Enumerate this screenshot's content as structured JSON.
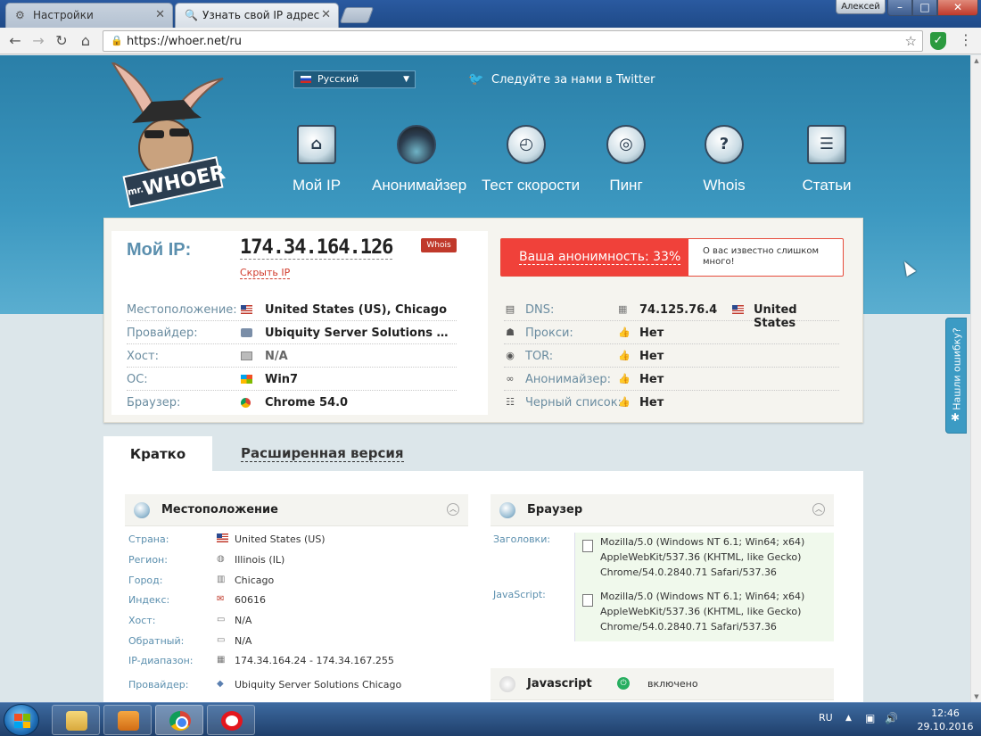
{
  "browser": {
    "tabs": [
      {
        "title": "Настройки",
        "icon": "gear-icon"
      },
      {
        "title": "Узнать свой IP адрес",
        "icon": "search-icon"
      }
    ],
    "profile_name": "Алексей",
    "url": "https://whoer.net/ru"
  },
  "header": {
    "logo_small": "mr.",
    "logo_text": "WHOER",
    "language": "Русский",
    "twitter_text": "Следуйте за нами в Twitter",
    "nav": [
      {
        "label": "Мой IP",
        "icon": "home-icon"
      },
      {
        "label": "Анонимайзер",
        "icon": "spy-hat-icon"
      },
      {
        "label": "Тест скорости",
        "icon": "speedometer-icon"
      },
      {
        "label": "Пинг",
        "icon": "ping-icon"
      },
      {
        "label": "Whois",
        "icon": "question-icon"
      },
      {
        "label": "Статьи",
        "icon": "articles-icon"
      }
    ]
  },
  "ip_panel": {
    "my_ip_label": "Мой IP:",
    "ip": "174.34.164.126",
    "hide_ip": "Скрыть IP",
    "whois_badge": "Whois",
    "rows": [
      {
        "label": "Местоположение:",
        "value": "United States (US), Chicago",
        "icon": "us-flag-icon"
      },
      {
        "label": "Провайдер:",
        "value": "Ubiquity Server Solutions Chic…",
        "icon": "provider-icon"
      },
      {
        "label": "Хост:",
        "value": "N/A",
        "icon": "host-icon"
      },
      {
        "label": "ОС:",
        "value": "Win7",
        "icon": "windows-icon"
      },
      {
        "label": "Браузер:",
        "value": "Chrome 54.0",
        "icon": "chrome-icon"
      }
    ],
    "anonymity_label": "Ваша анонимность: 33%",
    "anonymity_percent": 33,
    "anonymity_note": "О вас известно слишком много!",
    "checks": [
      {
        "label": "DNS:",
        "value": "74.125.76.4",
        "extra": "United States",
        "icon": "dns-icon"
      },
      {
        "label": "Прокси:",
        "value": "Нет",
        "icon": "proxy-icon"
      },
      {
        "label": "TOR:",
        "value": "Нет",
        "icon": "tor-icon"
      },
      {
        "label": "Анонимайзер:",
        "value": "Нет",
        "icon": "glasses-icon"
      },
      {
        "label": "Черный список:",
        "value": "Нет",
        "icon": "blacklist-icon"
      }
    ]
  },
  "tabs": {
    "short": "Кратко",
    "extended": "Расширенная версия"
  },
  "location_section": {
    "title": "Местоположение",
    "rows": [
      {
        "label": "Страна:",
        "value": "United States (US)"
      },
      {
        "label": "Регион:",
        "value": "Illinois (IL)"
      },
      {
        "label": "Город:",
        "value": "Chicago"
      },
      {
        "label": "Индекс:",
        "value": "60616"
      },
      {
        "label": "Хост:",
        "value": "N/A"
      },
      {
        "label": "Обратный:",
        "value": "N/A"
      },
      {
        "label": "IP-диапазон:",
        "value": "174.34.164.24 - 174.34.167.255"
      },
      {
        "label": "Провайдер:",
        "value": "Ubiquity Server Solutions Chicago"
      }
    ]
  },
  "browser_section": {
    "title": "Браузер",
    "headers_label": "Заголовки:",
    "headers_value": "Mozilla/5.0 (Windows NT 6.1; Win64; x64) AppleWebKit/537.36 (KHTML, like Gecko) Chrome/54.0.2840.71 Safari/537.36",
    "js_label": "JavaScript:",
    "js_value": "Mozilla/5.0 (Windows NT 6.1; Win64; x64) AppleWebKit/537.36 (KHTML, like Gecko) Chrome/54.0.2840.71 Safari/537.36"
  },
  "javascript_section": {
    "title": "Javascript",
    "status": "включено"
  },
  "error_tab": "Нашли ошибку?",
  "taskbar": {
    "lang": "RU",
    "time": "12:46",
    "date": "29.10.2016"
  }
}
